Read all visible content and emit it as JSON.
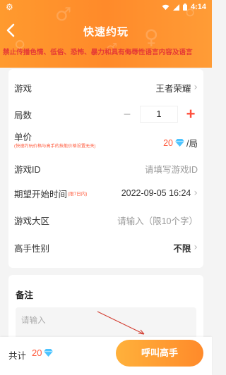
{
  "status_bar": {
    "time": "4:14",
    "settings_icon": "gear-icon",
    "wifi_icon": "wifi-icon",
    "signal_icon": "signal-icon",
    "battery_icon": "battery-icon"
  },
  "nav": {
    "title": "快速约玩",
    "back_icon": "chevron-left-icon"
  },
  "notice": "禁止传播色情、低俗、恐怖、暴力和具有侮辱性语言内容及语言",
  "form": {
    "game": {
      "label": "游戏",
      "value": "王者荣耀"
    },
    "rounds": {
      "label": "局数",
      "value": "1",
      "minus": "−",
      "plus": "+"
    },
    "price": {
      "label": "单价",
      "note": "(快速约玩价格与高手的技能价格设置无关)",
      "value": "20",
      "unit": "/局",
      "currency_icon": "diamond-icon"
    },
    "game_id": {
      "label": "游戏ID",
      "placeholder": "请填写游戏ID"
    },
    "start_time": {
      "label": "期望开始时间",
      "note": "(限7日内)",
      "value": "2022-09-05 16:24"
    },
    "region": {
      "label": "游戏大区",
      "placeholder": "请输入（限10个字）"
    },
    "gender": {
      "label": "高手性别",
      "value": "不限"
    }
  },
  "remark": {
    "title": "备注",
    "placeholder": "请输入"
  },
  "footer": {
    "total_label": "共计",
    "total_value": "20",
    "currency_icon": "diamond-icon",
    "call_button": "呼叫高手"
  },
  "colors": {
    "accent": "#ff8a2a",
    "price_red": "#ff5a3c",
    "diamond": "#4cc3ff"
  }
}
